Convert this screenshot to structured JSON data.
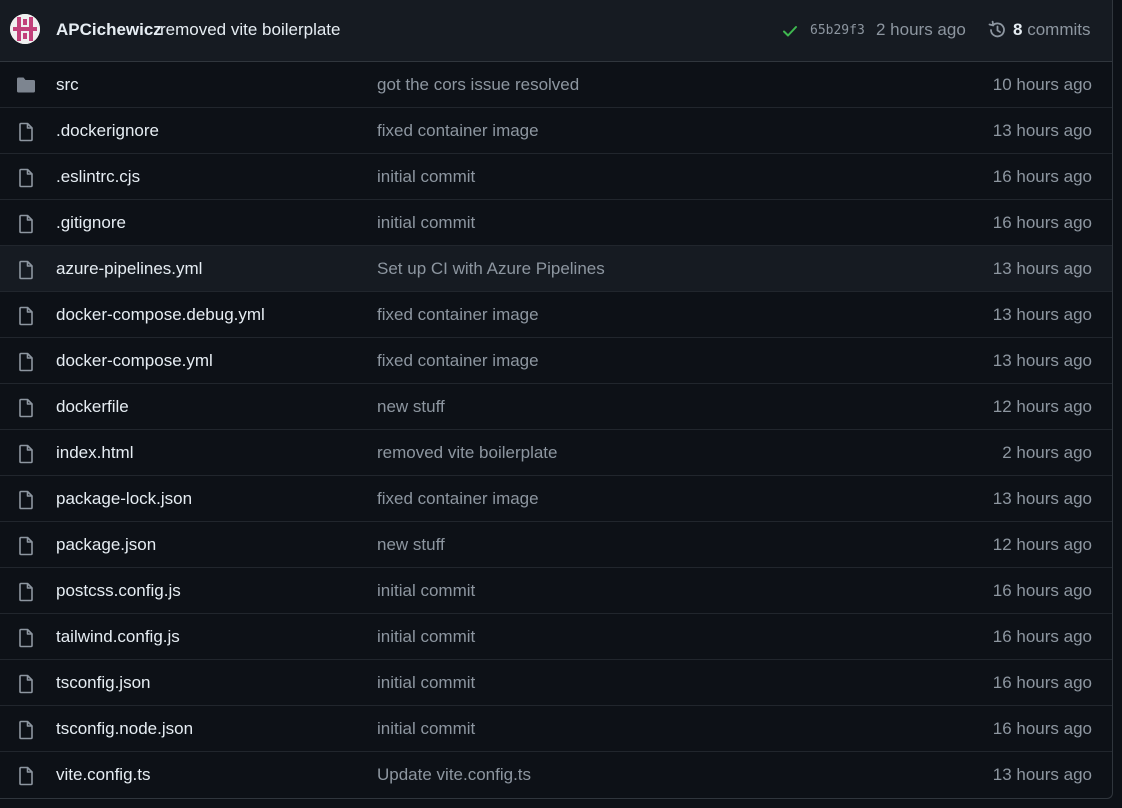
{
  "colors": {
    "background": "#0d1117",
    "header_background": "#161b22",
    "border": "#30363d",
    "text": "#e6edf3",
    "muted": "#8d96a0",
    "success": "#3fb950",
    "folder": "#7d8590",
    "avatar_accent": "#c2417a"
  },
  "latest_commit": {
    "author": "APCichewicz",
    "message": "removed vite boilerplate",
    "status_icon": "check-icon",
    "sha": "65b29f3",
    "time": "2 hours ago",
    "history_icon": "history-icon",
    "commit_count": "8",
    "commits_label": "commits"
  },
  "files": [
    {
      "type": "dir",
      "icon": "folder-icon",
      "name": "src",
      "message": "got the cors issue resolved",
      "age": "10 hours ago"
    },
    {
      "type": "file",
      "icon": "file-icon",
      "name": ".dockerignore",
      "message": "fixed container image",
      "age": "13 hours ago"
    },
    {
      "type": "file",
      "icon": "file-icon",
      "name": ".eslintrc.cjs",
      "message": "initial commit",
      "age": "16 hours ago"
    },
    {
      "type": "file",
      "icon": "file-icon",
      "name": ".gitignore",
      "message": "initial commit",
      "age": "16 hours ago"
    },
    {
      "type": "file",
      "icon": "file-icon",
      "name": "azure-pipelines.yml",
      "message": "Set up CI with Azure Pipelines",
      "age": "13 hours ago",
      "hover": true
    },
    {
      "type": "file",
      "icon": "file-icon",
      "name": "docker-compose.debug.yml",
      "message": "fixed container image",
      "age": "13 hours ago"
    },
    {
      "type": "file",
      "icon": "file-icon",
      "name": "docker-compose.yml",
      "message": "fixed container image",
      "age": "13 hours ago"
    },
    {
      "type": "file",
      "icon": "file-icon",
      "name": "dockerfile",
      "message": "new stuff",
      "age": "12 hours ago"
    },
    {
      "type": "file",
      "icon": "file-icon",
      "name": "index.html",
      "message": "removed vite boilerplate",
      "age": "2 hours ago"
    },
    {
      "type": "file",
      "icon": "file-icon",
      "name": "package-lock.json",
      "message": "fixed container image",
      "age": "13 hours ago"
    },
    {
      "type": "file",
      "icon": "file-icon",
      "name": "package.json",
      "message": "new stuff",
      "age": "12 hours ago"
    },
    {
      "type": "file",
      "icon": "file-icon",
      "name": "postcss.config.js",
      "message": "initial commit",
      "age": "16 hours ago"
    },
    {
      "type": "file",
      "icon": "file-icon",
      "name": "tailwind.config.js",
      "message": "initial commit",
      "age": "16 hours ago"
    },
    {
      "type": "file",
      "icon": "file-icon",
      "name": "tsconfig.json",
      "message": "initial commit",
      "age": "16 hours ago"
    },
    {
      "type": "file",
      "icon": "file-icon",
      "name": "tsconfig.node.json",
      "message": "initial commit",
      "age": "16 hours ago"
    },
    {
      "type": "file",
      "icon": "file-icon",
      "name": "vite.config.ts",
      "message": "Update vite.config.ts",
      "age": "13 hours ago"
    }
  ]
}
